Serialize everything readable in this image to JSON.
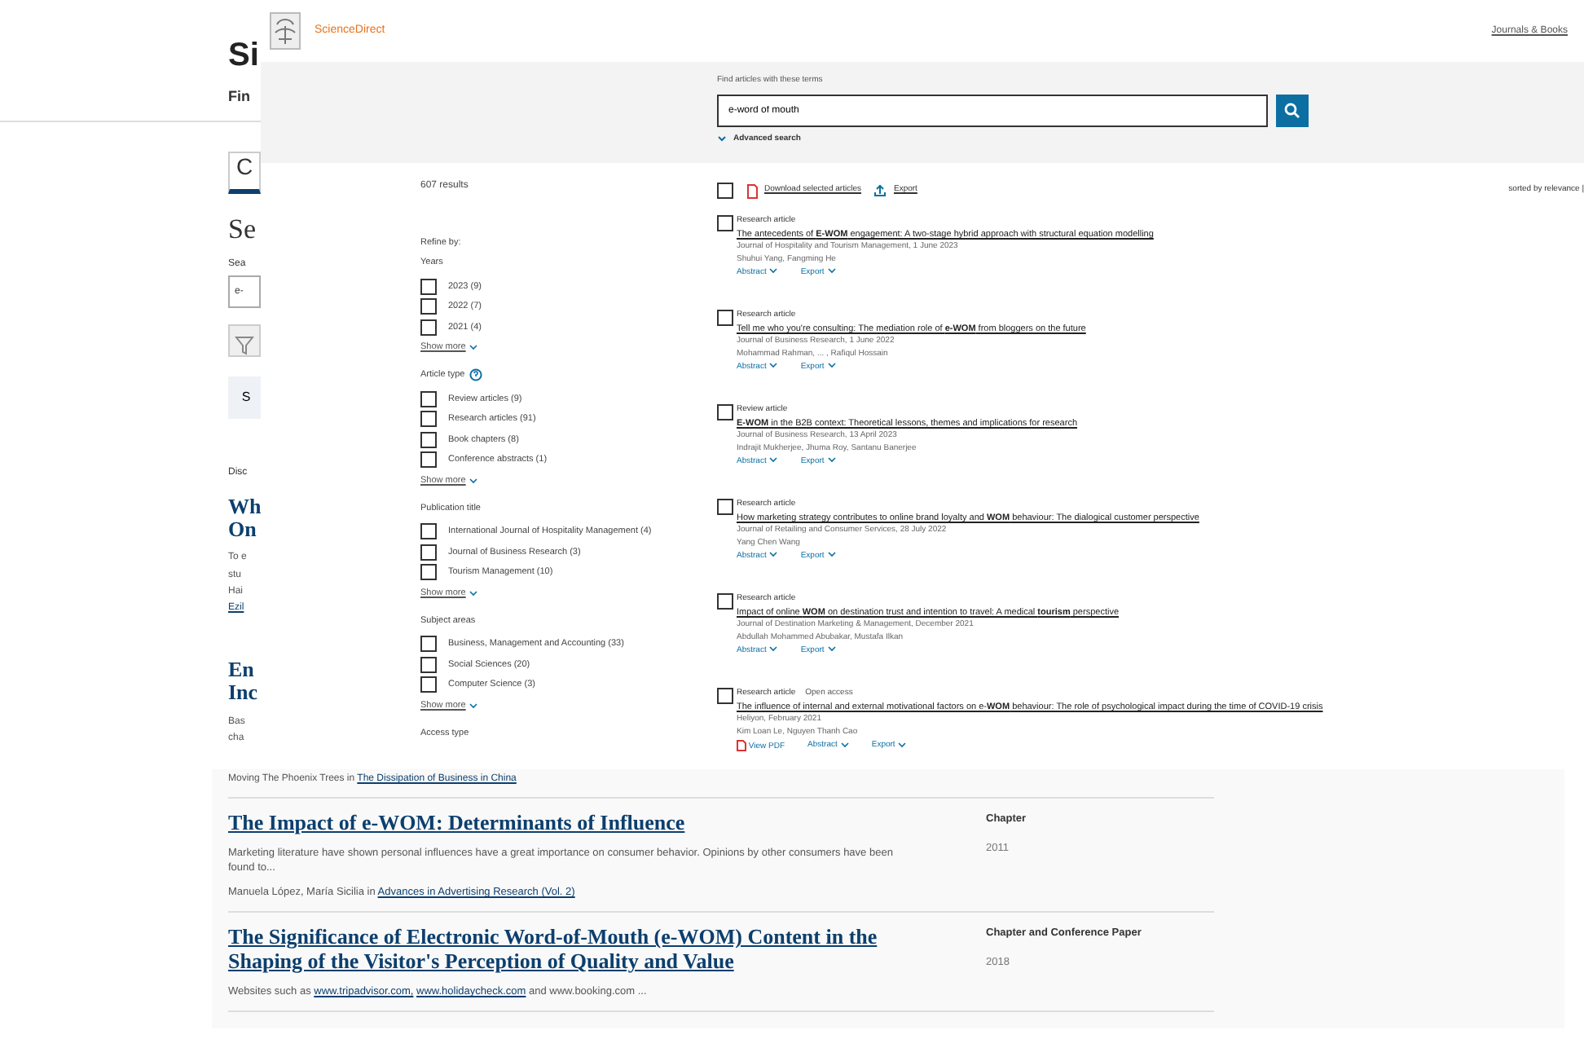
{
  "background_page": {
    "fragments": [
      {
        "kind": "logo",
        "text": "Si"
      },
      {
        "kind": "nav",
        "text": "Fin"
      },
      {
        "kind": "tab",
        "text": "C"
      },
      {
        "kind": "heading",
        "text": "Se"
      },
      {
        "kind": "label",
        "text": "Sea"
      },
      {
        "kind": "field",
        "text": "e-"
      },
      {
        "kind": "icon-button"
      },
      {
        "kind": "button",
        "text": "S"
      },
      {
        "kind": "type",
        "text": "Disc"
      },
      {
        "kind": "title",
        "text": "Wh"
      },
      {
        "kind": "title",
        "text": "On"
      },
      {
        "kind": "text",
        "text": "To e"
      },
      {
        "kind": "text",
        "text": "stu"
      },
      {
        "kind": "text",
        "text": "Hai"
      },
      {
        "kind": "link",
        "text": "Ezil"
      },
      {
        "kind": "title",
        "text": "En"
      },
      {
        "kind": "title",
        "text": "Inc"
      },
      {
        "kind": "text",
        "text": "Bas"
      },
      {
        "kind": "text",
        "text": "cha"
      }
    ],
    "byline": {
      "text": "Moving The Phoenix Trees in",
      "link": "The Dissipation of Business in China"
    },
    "results": [
      {
        "title": "The Impact of e-WOM: Determinants of Influence",
        "type": "Chapter",
        "year": "2011",
        "snippet": "Marketing literature have shown personal influences have a great importance on consumer behavior. Opinions by other consumers have been found to...",
        "authors": "Manuela López, María Sicilia in",
        "source": "Advances in Advertising Research (Vol. 2)"
      },
      {
        "title": "The Significance of Electronic Word-of-Mouth (e-WOM) Content in the Shaping of the Visitor's Perception of Quality and Value",
        "type": "Chapter and Conference Paper",
        "year": "2018",
        "snippet": "Websites such as",
        "links": [
          "www.tripadvisor.com,",
          "www.holidaycheck.com"
        ],
        "snippet_end": "and www.booking.com ..."
      }
    ]
  },
  "sciencedirect": {
    "header": {
      "brand": "ScienceDirect",
      "right_link": "Journals & Books"
    },
    "search": {
      "label": "Find articles with these terms",
      "value": "e-word of mouth",
      "advanced": "Advanced search"
    },
    "results_count": "607 results",
    "refine": {
      "title": "Refine by:",
      "groups": [
        {
          "title": "Years",
          "has_help": false,
          "options": [
            {
              "label": "2023 (9)",
              "checked": false
            },
            {
              "label": "2022 (7)",
              "checked": false
            },
            {
              "label": "2021 (4)",
              "checked": false
            }
          ],
          "show_more": "Show more"
        },
        {
          "title": "Article type",
          "has_help": true,
          "options": [
            {
              "label": "Review articles (9)",
              "checked": false
            },
            {
              "label": "Research articles (91)",
              "checked": false
            },
            {
              "label": "Book chapters (8)",
              "checked": false
            },
            {
              "label": "Conference abstracts (1)",
              "checked": false
            }
          ],
          "show_more": "Show more"
        },
        {
          "title": "Publication title",
          "has_help": false,
          "options": [
            {
              "label": "International Journal of Hospitality Management (4)",
              "checked": false
            },
            {
              "label": "Journal of Business Research (3)",
              "checked": false
            },
            {
              "label": "Tourism Management (10)",
              "checked": false
            }
          ],
          "show_more": "Show more"
        },
        {
          "title": "Subject areas",
          "has_help": false,
          "options": [
            {
              "label": "Business, Management and Accounting (33)",
              "checked": false
            },
            {
              "label": "Social Sciences (20)",
              "checked": false
            },
            {
              "label": "Computer Science (3)",
              "checked": false
            }
          ],
          "show_more": "Show more"
        }
      ],
      "access_type": "Access type"
    },
    "toolbar": {
      "select_all_checked": false,
      "download": "Download selected articles",
      "export": "Export",
      "sort": "sorted by relevance |"
    },
    "articles": [
      {
        "type": "Research article",
        "checked": false,
        "title": "The antecedents of **E-WOM** engagement: A two-stage hybrid approach with structural equation modelling",
        "source": "Journal of Hospitality and Tourism Management, 1 June 2023",
        "authors": "Shuhui Yang, Fangming He",
        "abstract": "Abstract",
        "export": "Export"
      },
      {
        "type": "Research article",
        "checked": false,
        "title": "Tell me who you're consulting: The mediation role of **e-WOM** from bloggers on the future",
        "source": "Journal of Business Research, 1 June 2022",
        "authors": "Mohammad Rahman, ... , Rafiqul Hossain",
        "abstract": "Abstract",
        "export": "Export"
      },
      {
        "type": "Review article",
        "checked": false,
        "title": "**E-WOM** in the B2B context: Theoretical lessons, themes and implications for research",
        "source": "Journal of Business Research, 13 April 2023",
        "authors": "Indrajit Mukherjee, Jhuma Roy, Santanu Banerjee",
        "abstract": "Abstract",
        "export": "Export"
      },
      {
        "type": "Research article",
        "checked": false,
        "title": "How marketing strategy contributes to online brand loyalty and **WOM** behaviour: The dialogical customer perspective",
        "source": "Journal of Retailing and Consumer Services, 28 July 2022",
        "authors": "Yang Chen Wang",
        "abstract": "Abstract",
        "export": "Export"
      },
      {
        "type": "Research article",
        "checked": false,
        "title": "Impact of online **WOM** on destination trust and intention to travel: A medical **tourism** perspective",
        "source": "Journal of Destination Marketing & Management, December 2021",
        "authors": "Abdullah Mohammed Abubakar, Mustafa Ilkan",
        "abstract": "Abstract",
        "export": "Export"
      },
      {
        "type": "Research article",
        "access_label": "Open access",
        "checked": false,
        "title": "The influence of internal and external motivational factors on e-**WOM** behaviour: The role of psychological impact during the time of COVID-19 crisis",
        "source": "Heliyon, February 2021",
        "authors": "Kim Loan Le, Nguyen Thanh Cao",
        "pdf_label": "View PDF",
        "abstract": "Abstract",
        "export": "Export"
      }
    ]
  }
}
